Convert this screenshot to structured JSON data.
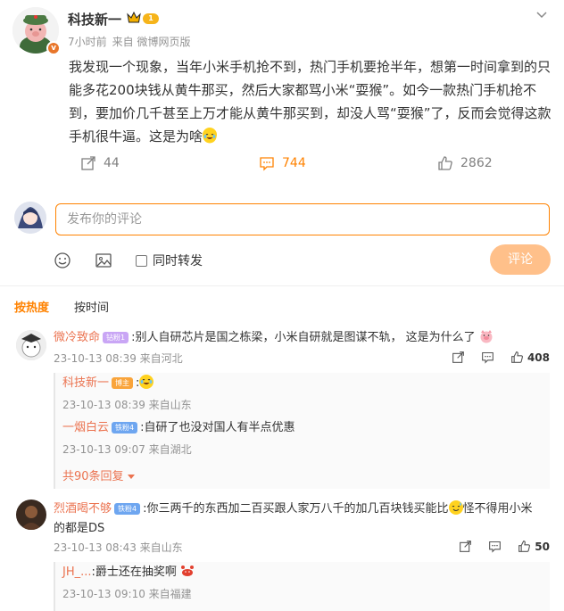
{
  "post": {
    "author": "科技新一",
    "level_badge": "1",
    "time": "7小时前",
    "source": "来自 微博网页版",
    "content": "我发现一个现象，当年小米手机抢不到，热门手机要抢半年，想第一时间拿到的只能多花200块钱从黄牛那买，然后大家都骂小米“耍猴”。如今一款热门手机抢不到，要加价几千甚至上万才能从黄牛那买到，却没人骂“耍猴”了，反而会觉得这款手机很牛逼。这是为啥",
    "repost_count": "44",
    "comment_count": "744",
    "like_count": "2862"
  },
  "composer": {
    "placeholder": "发布你的评论",
    "repost_label": "同时转发",
    "submit_label": "评论"
  },
  "sort_tabs": [
    "按热度",
    "按时间"
  ],
  "comments": [
    {
      "user": "微冷致命",
      "badge": "钻粉1",
      "text": ":别人自研芯片是国之栋梁，小米自研就是图谋不轨， 这是为什么了",
      "time": "23-10-13 08:39 来自河北",
      "likes": "408",
      "replies": [
        {
          "user": "科技新一",
          "badge": "博主",
          "text": ":",
          "time": "23-10-13 08:39 来自山东"
        },
        {
          "user": "一烟白云",
          "badge": "铁粉4",
          "text": ":自研了也没对国人有半点优惠",
          "time": "23-10-13 09:07 来自湖北"
        }
      ],
      "more": "共90条回复"
    },
    {
      "user": "烈酒喝不够",
      "badge": "铁粉4",
      "text_line1": ":你三两千的东西加二百买跟人家万八千的加几百块钱买能比",
      "text_line1b": "怪不得用小米",
      "text_line2": "的都是DS",
      "time": "23-10-13 08:43 来自山东",
      "likes": "50",
      "replies": [
        {
          "user": "JH_...",
          "text": ":爵士还在抽奖啊",
          "time": "23-10-13 09:10 来自福建"
        }
      ]
    }
  ],
  "colors": {
    "accent": "#ff8200",
    "username": "#eb7350",
    "meta": "#939393"
  }
}
